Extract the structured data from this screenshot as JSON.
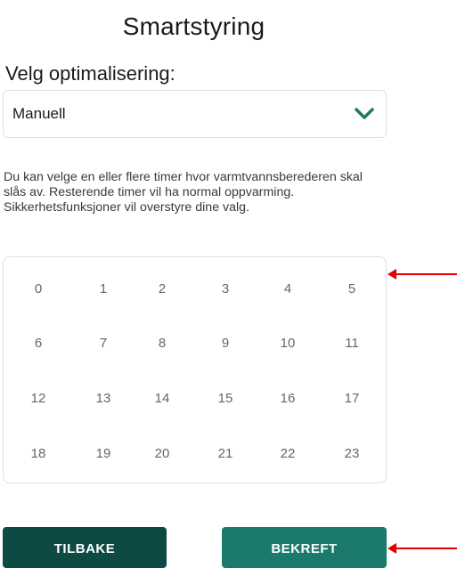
{
  "header": {
    "title": "Smartstyring"
  },
  "optimization": {
    "label": "Velg optimalisering:",
    "selected_value": "Manuell",
    "chevron_icon": "chevron-down-icon",
    "chevron_color": "#1b7a5c"
  },
  "description": "Du kan velge en eller flere timer hvor varmtvannsberederen skal slås av. Resterende timer vil ha normal oppvarming. Sikkerhetsfunksjoner vil overstyre dine valg.",
  "hours": [
    "0",
    "1",
    "2",
    "3",
    "4",
    "5",
    "6",
    "7",
    "8",
    "9",
    "10",
    "11",
    "12",
    "13",
    "14",
    "15",
    "16",
    "17",
    "18",
    "19",
    "20",
    "21",
    "22",
    "23"
  ],
  "buttons": {
    "back_label": "TILBAKE",
    "confirm_label": "BEKREFT"
  },
  "colors": {
    "back_button": "#0d4a44",
    "confirm_button": "#1b7a6c",
    "annotation_arrow": "#e00000"
  }
}
